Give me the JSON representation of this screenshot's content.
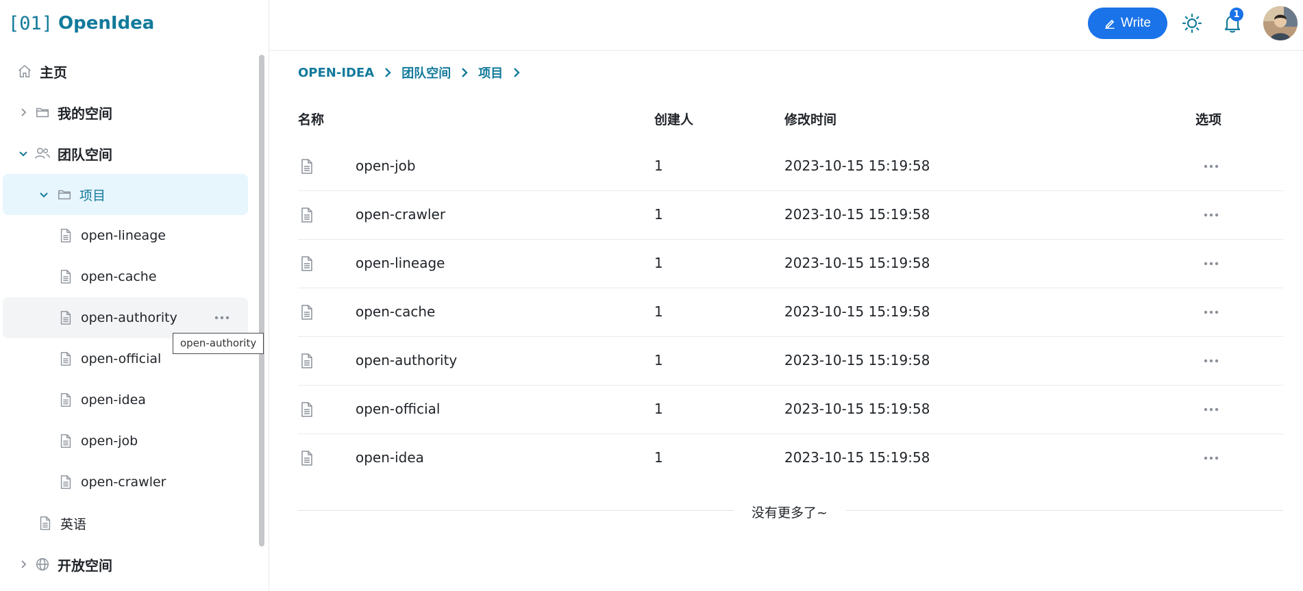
{
  "brand": {
    "code": "[01]",
    "name": "OpenIdea"
  },
  "sidebar": {
    "items": [
      {
        "label": "主页",
        "icon": "home-icon"
      },
      {
        "label": "我的空间",
        "icon": "folder-icon"
      },
      {
        "label": "团队空间",
        "icon": "users-icon"
      },
      {
        "label": "项目",
        "icon": "folder-icon"
      },
      {
        "label": "open-lineage",
        "icon": "document-icon"
      },
      {
        "label": "open-cache",
        "icon": "document-icon"
      },
      {
        "label": "open-authority",
        "icon": "document-icon"
      },
      {
        "label": "open-official",
        "icon": "document-icon"
      },
      {
        "label": "open-idea",
        "icon": "document-icon"
      },
      {
        "label": "open-job",
        "icon": "document-icon"
      },
      {
        "label": "open-crawler",
        "icon": "document-icon"
      },
      {
        "label": "英语",
        "icon": "document-icon"
      },
      {
        "label": "开放空间",
        "icon": "globe-icon"
      }
    ],
    "tooltip": "open-authority"
  },
  "header": {
    "write_label": "Write",
    "notification_count": "1",
    "accent": "#1a73e8"
  },
  "breadcrumb": [
    "OPEN-IDEA",
    "团队空间",
    "项目"
  ],
  "table": {
    "headers": {
      "name": "名称",
      "creator": "创建人",
      "modified": "修改时间",
      "options": "选项"
    },
    "rows": [
      {
        "name": "open-job",
        "creator": "1",
        "modified": "2023-10-15 15:19:58"
      },
      {
        "name": "open-crawler",
        "creator": "1",
        "modified": "2023-10-15 15:19:58"
      },
      {
        "name": "open-lineage",
        "creator": "1",
        "modified": "2023-10-15 15:19:58"
      },
      {
        "name": "open-cache",
        "creator": "1",
        "modified": "2023-10-15 15:19:58"
      },
      {
        "name": "open-authority",
        "creator": "1",
        "modified": "2023-10-15 15:19:58"
      },
      {
        "name": "open-official",
        "creator": "1",
        "modified": "2023-10-15 15:19:58"
      },
      {
        "name": "open-idea",
        "creator": "1",
        "modified": "2023-10-15 15:19:58"
      }
    ],
    "end_text": "没有更多了~"
  },
  "colors": {
    "brand": "#127a9b",
    "selected_bg": "#e7f5fc"
  }
}
